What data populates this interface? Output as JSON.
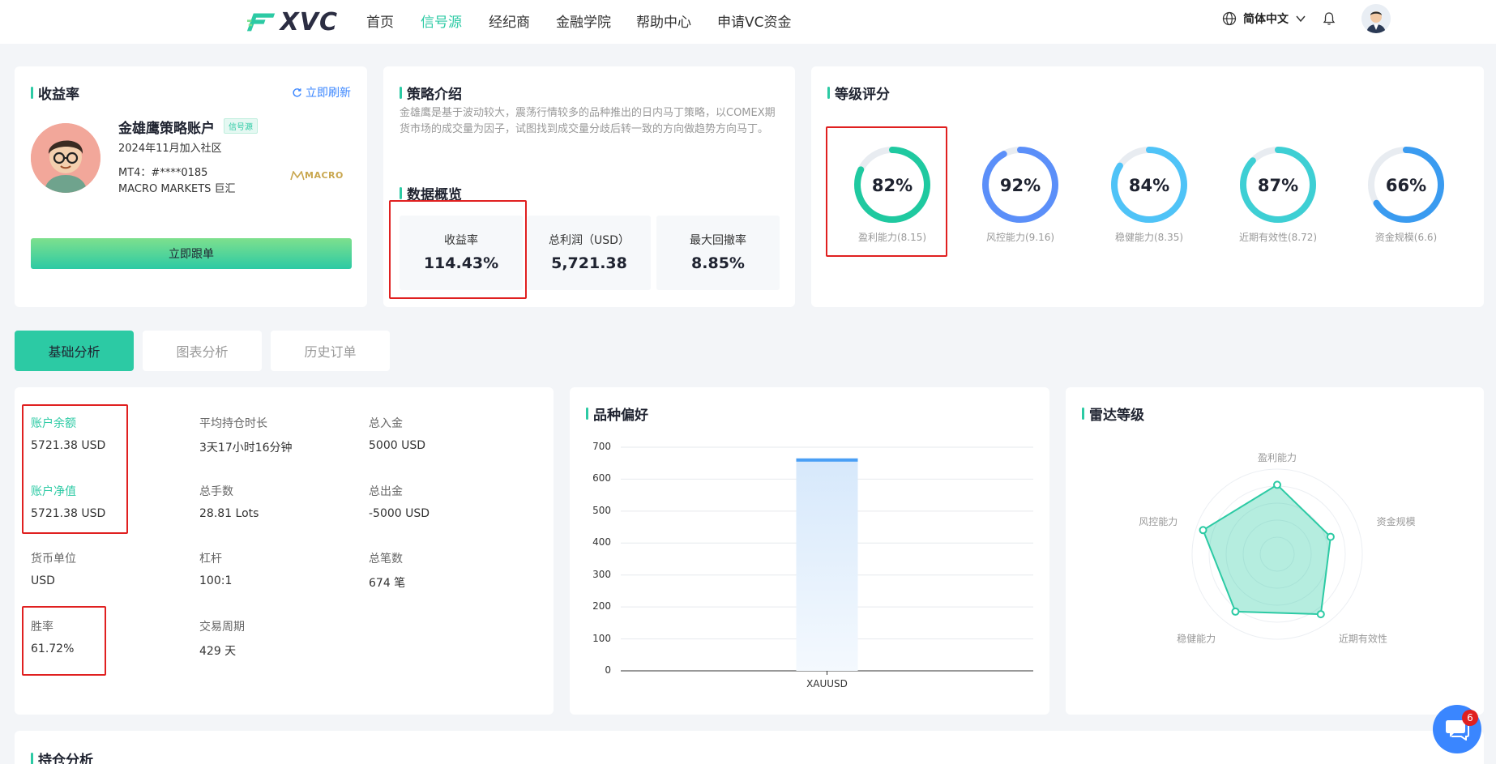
{
  "nav": {
    "logo_text": "XVC",
    "items": [
      "首页",
      "信号源",
      "经纪商",
      "金融学院",
      "帮助中心",
      "申请VC资金"
    ],
    "active_index": 1,
    "language": "简体中文"
  },
  "profit_card": {
    "title": "收益率",
    "refresh": "立即刷新",
    "account_name": "金雄鹰策略账户",
    "badge": "信号源",
    "joined": "2024年11月加入社区",
    "mt4": "MT4：#****0185",
    "broker": "MACRO MARKETS 巨汇",
    "broker_logo": "MACRO",
    "follow_button": "立即跟单"
  },
  "strategy_card": {
    "title": "策略介绍",
    "description": "金雄鹰是基于波动较大，震荡行情较多的品种推出的日内马丁策略，以COMEX期货市场的成交量为因子，试图找到成交量分歧后转一致的方向做趋势方向马丁。",
    "overview_title": "数据概览",
    "stats": [
      {
        "label": "收益率",
        "value": "114.43%"
      },
      {
        "label": "总利润（USD）",
        "value": "5,721.38"
      },
      {
        "label": "最大回撤率",
        "value": "8.85%"
      }
    ]
  },
  "rating_card": {
    "title": "等级评分",
    "gauges": [
      {
        "value": "82%",
        "percent": 82,
        "label": "盈利能力(8.15)",
        "color": "#1fc9a0"
      },
      {
        "value": "92%",
        "percent": 92,
        "label": "风控能力(9.16)",
        "color": "#5b8ff9"
      },
      {
        "value": "84%",
        "percent": 84,
        "label": "稳健能力(8.35)",
        "color": "#4fc3f7"
      },
      {
        "value": "87%",
        "percent": 87,
        "label": "近期有效性(8.72)",
        "color": "#3ecfd4"
      },
      {
        "value": "66%",
        "percent": 66,
        "label": "资金规模(6.6)",
        "color": "#3a9bf0"
      }
    ]
  },
  "tabs": [
    "基础分析",
    "图表分析",
    "历史订单"
  ],
  "active_tab": 0,
  "details": [
    {
      "label": "账户余额",
      "value": "5721.38 USD",
      "highlight": true
    },
    {
      "label": "平均持仓时长",
      "value": "3天17小时16分钟",
      "highlight": false
    },
    {
      "label": "总入金",
      "value": "5000 USD",
      "highlight": false
    },
    {
      "label": "账户净值",
      "value": "5721.38 USD",
      "highlight": true
    },
    {
      "label": "总手数",
      "value": "28.81 Lots",
      "highlight": false
    },
    {
      "label": "总出金",
      "value": "-5000 USD",
      "highlight": false
    },
    {
      "label": "货币单位",
      "value": "USD",
      "highlight": false
    },
    {
      "label": "杠杆",
      "value": "100:1",
      "highlight": false
    },
    {
      "label": "总笔数",
      "value": "674 笔",
      "highlight": false
    },
    {
      "label": "胜率",
      "value": "61.72%",
      "highlight": false
    },
    {
      "label": "交易周期",
      "value": "429 天",
      "highlight": false
    }
  ],
  "variety_card": {
    "title": "品种偏好",
    "chart_data": {
      "type": "bar",
      "categories": [
        "XAUUSD"
      ],
      "values": [
        665
      ],
      "ylim": [
        0,
        700
      ],
      "yticks": [
        0,
        100,
        200,
        300,
        400,
        500,
        600,
        700
      ],
      "grid": true,
      "color": "#4a9ff5"
    }
  },
  "radar_card": {
    "title": "雷达等级",
    "chart_data": {
      "type": "radar",
      "axes": [
        "盈利能力",
        "资金规模",
        "近期有效性",
        "稳健能力",
        "风控能力"
      ],
      "values": [
        8.15,
        6.6,
        8.72,
        8.35,
        9.16
      ],
      "max": 10,
      "color": "#2ccaa4"
    }
  },
  "position_card": {
    "title": "持仓分析"
  },
  "chat": {
    "badge_count": "6"
  }
}
